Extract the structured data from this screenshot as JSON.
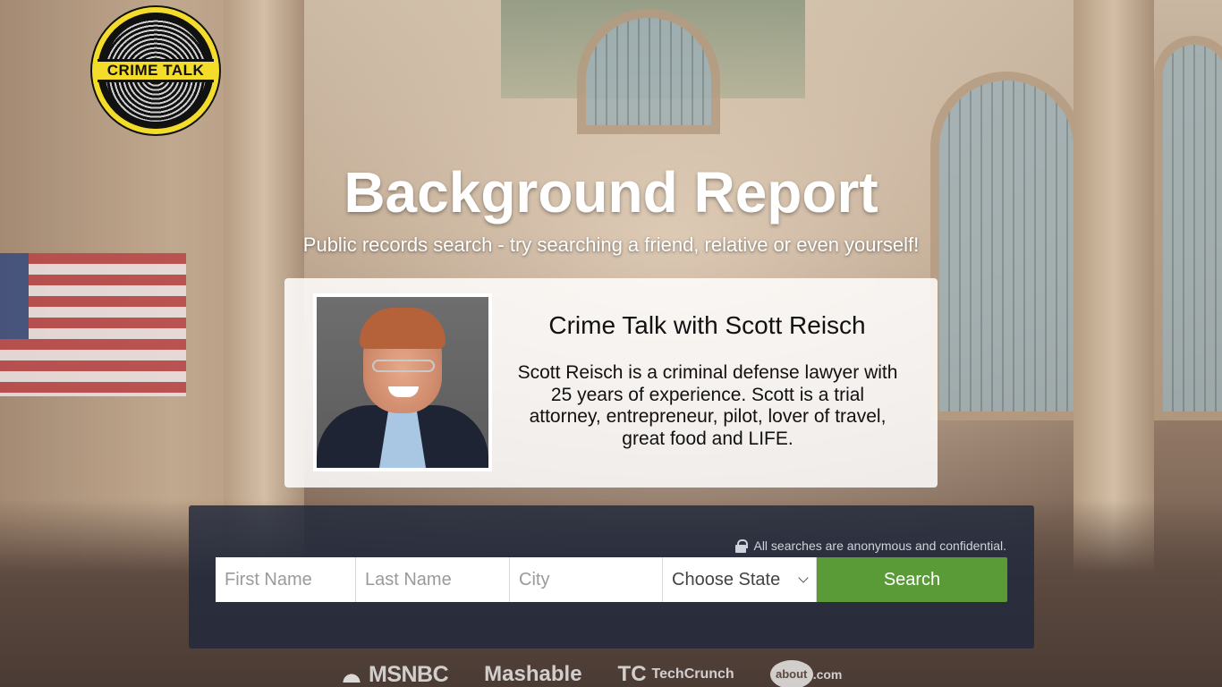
{
  "brand": {
    "logo_text": "CRIME TALK",
    "logo_colors": {
      "ring": "#f4dd2a",
      "fill": "#111111"
    }
  },
  "hero": {
    "title": "Background Report",
    "subtitle": "Public records search - try searching a friend, relative or even yourself!"
  },
  "profile": {
    "title": "Crime Talk with Scott Reisch",
    "bio": "Scott Reisch is a criminal defense lawyer with 25 years of experience. Scott is a trial attorney, entrepreneur, pilot, lover of travel, great food and LIFE."
  },
  "search": {
    "privacy_note": "All searches are anonymous and confidential.",
    "first_name_placeholder": "First Name",
    "last_name_placeholder": "Last Name",
    "city_placeholder": "City",
    "state_selected": "Choose State",
    "button_label": "Search",
    "button_color": "#5a9b38"
  },
  "press": {
    "logos": [
      "MSNBC",
      "Mashable",
      "TechCrunch",
      "about.com"
    ],
    "msnbc": "MSNBC",
    "mashable": "Mashable",
    "techcrunch_mark": "TC",
    "techcrunch": "TechCrunch",
    "about_bubble": "about",
    "about_suffix": ".com"
  }
}
